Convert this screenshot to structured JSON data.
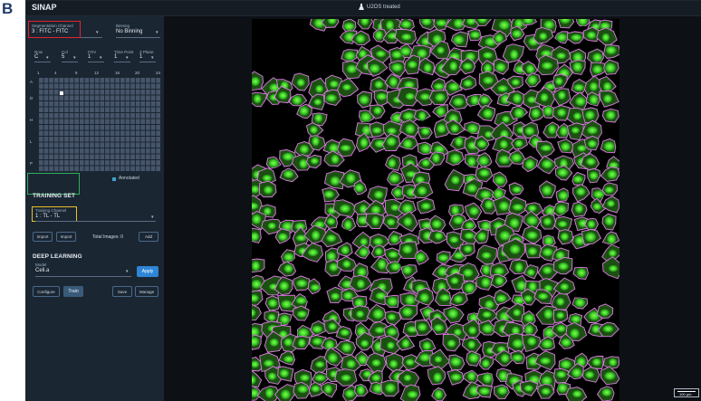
{
  "figure_label": "B",
  "app": {
    "title": "SINAP",
    "plate_name": "U2OS treated",
    "plate_icon": "flask-icon"
  },
  "segmentation": {
    "label": "Segmentation Channel",
    "value": "3 : FITC - FITC"
  },
  "binning": {
    "label": "Binning",
    "value": "No Binning"
  },
  "selectors": [
    {
      "label": "Row",
      "value": "C"
    },
    {
      "label": "Col",
      "value": "5"
    },
    {
      "label": "FOV",
      "value": "1"
    },
    {
      "label": "Time Point",
      "value": "1"
    },
    {
      "label": "Z Plane",
      "value": "1"
    }
  ],
  "plate_grid": {
    "column_labels": [
      "1",
      "4",
      "8",
      "12",
      "16",
      "20",
      "24"
    ],
    "row_labels": [
      "A",
      "D",
      "H",
      "L",
      "P"
    ]
  },
  "legend": {
    "label": "Annotated",
    "color": "#3fa3c9"
  },
  "training": {
    "section_title": "TRAINING SET",
    "channel_label": "Training Channel",
    "channel_value": "1 : TL - TL",
    "buttons": {
      "import1": "Import",
      "import2": "Import",
      "add": "Add"
    },
    "total_images": "Total Images: 0"
  },
  "deep_learning": {
    "section_title": "DEEP LEARNING",
    "model_label": "Model",
    "model_value": "Cell.a",
    "apply": "Apply",
    "configure": "Configure",
    "train": "Train",
    "save": "Save",
    "manage": "Manage"
  },
  "scalebar": {
    "label": "100 µm"
  },
  "colors": {
    "highlight_red": "#e0242a",
    "highlight_green": "#2fae5a",
    "highlight_yellow": "#e7c12a",
    "cell_fill": "#3fd12a",
    "cell_outline": "#e07be8",
    "accent": "#2f86d6"
  }
}
